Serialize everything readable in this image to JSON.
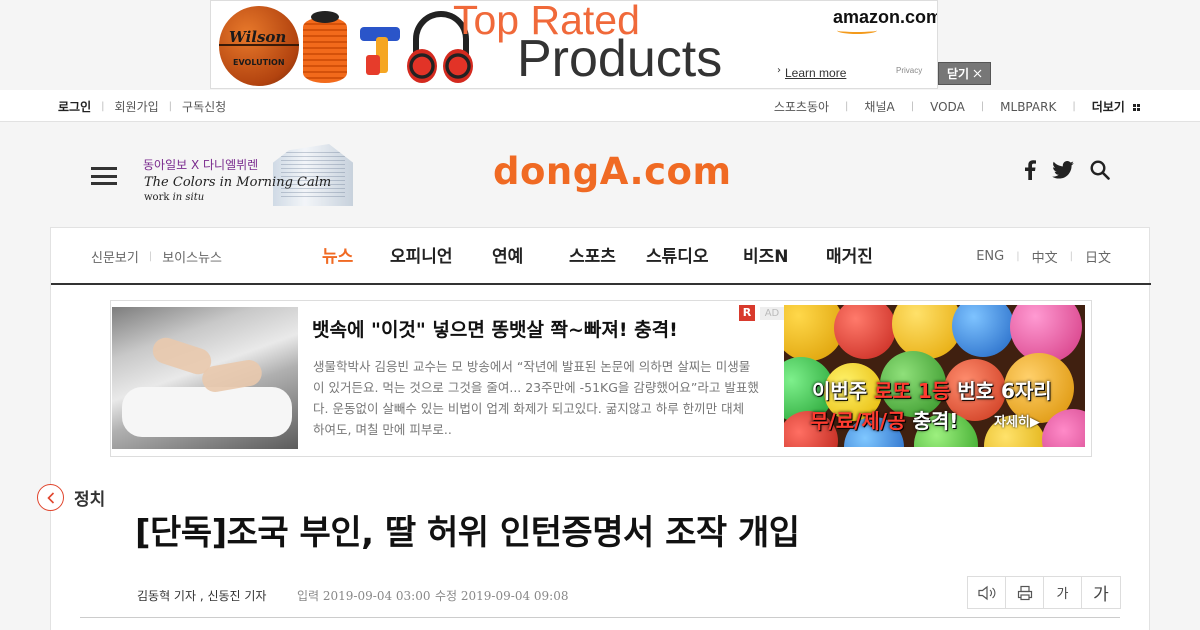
{
  "top_ad": {
    "ball_brand": "Wilson",
    "ball_model": "EVOLUTION",
    "headline_1": "Top Rated",
    "headline_2": "Products",
    "brand": "amazon.com",
    "learn_more": "Learn more",
    "privacy": "Privacy",
    "close_label": "닫기"
  },
  "util_bar": {
    "login": "로그인",
    "signup": "회원가입",
    "subscribe": "구독신청",
    "links": [
      "스포츠동아",
      "채널A",
      "VODA",
      "MLBPARK"
    ],
    "more": "더보기"
  },
  "header": {
    "promo_line1": "동아일보 X 다니엘뷔렌",
    "promo_line2": "The Colors in Morning Calm",
    "promo_line3_a": "work ",
    "promo_line3_b": "in situ",
    "logo": "dongA.com",
    "icons": [
      "facebook-icon",
      "twitter-icon",
      "search-icon"
    ]
  },
  "nav": {
    "left": [
      "신문보기",
      "보이스뉴스"
    ],
    "main": [
      "뉴스",
      "오피니언",
      "연예",
      "스포츠",
      "스튜디오",
      "비즈N",
      "매거진"
    ],
    "active": "뉴스",
    "right": [
      "ENG",
      "中文",
      "日文"
    ]
  },
  "native_ad": {
    "title": "뱃속에 \"이것\" 넣으면 똥뱃살 쫙~빠져! 충격!",
    "body": "생물학박사 김응빈 교수는 모 방송에서 “작년에 발표된 논문에 의하면 살찌는 미생물이 있거든요. 먹는 것으로 그것을 줄여... 23주만에 -51KG을 감량했어요”라고 발표했다. 운동없이 살빼수 있는 비법이 업계 화제가 되고있다. 굶지않고 하루 한끼만 대체 하여도, 며칠 만에 피부로..",
    "badge": "R",
    "ad_tag": "AD",
    "lotto_l1_a": "이번주 ",
    "lotto_l1_b": "로또 1등",
    "lotto_l1_c": " 번호 6자리",
    "lotto_l2_a": "무/료/제/공",
    "lotto_l2_b": " 충격!",
    "lotto_more": "자세히▶"
  },
  "article": {
    "category": "정치",
    "headline": "[단독]조국 부인, 딸 허위 인턴증명서 조작 개입",
    "byline": "김동혁 기자 , 신동진 기자",
    "date_input": "입력 2019-09-04 03:00",
    "date_modified": "수정 2019-09-04 09:08",
    "tools": [
      "speaker-icon",
      "print-icon"
    ],
    "font_small": "가",
    "font_large": "가"
  },
  "colors": {
    "brand_orange": "#f06a23",
    "accent_red": "#e0452d"
  }
}
